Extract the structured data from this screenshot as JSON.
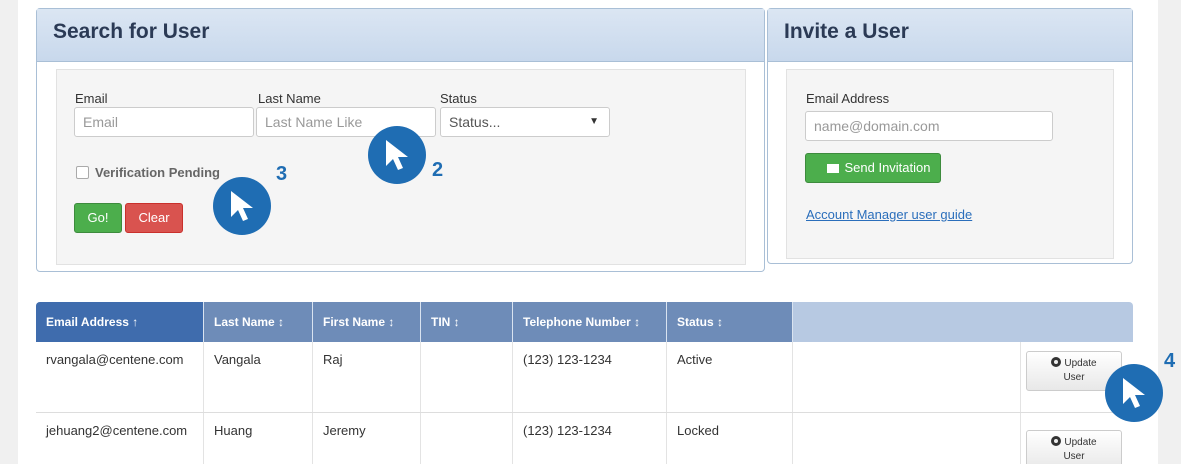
{
  "search": {
    "title": "Search for User",
    "email_label": "Email",
    "email_placeholder": "Email",
    "lastname_label": "Last Name",
    "lastname_placeholder": "Last Name Like",
    "status_label": "Status",
    "status_value": "Status...",
    "verification_label": "Verification Pending",
    "go_label": "Go!",
    "clear_label": "Clear"
  },
  "invite": {
    "title": "Invite a User",
    "email_label": "Email Address",
    "email_placeholder": "name@domain.com",
    "send_label": "Send Invitation",
    "guide_link": "Account Manager user guide"
  },
  "table": {
    "columns": [
      "Email Address ↑",
      "Last Name ↕",
      "First Name ↕",
      "TIN ↕",
      "Telephone Number ↕",
      "Status ↕"
    ],
    "update_label_1": "Update",
    "update_label_2": "User",
    "rows": [
      {
        "email": "rvangala@centene.com",
        "last": "Vangala",
        "first": "Raj",
        "tin": "",
        "phone": "(123) 123-1234",
        "status": "Active"
      },
      {
        "email": "jehuang2@centene.com",
        "last": "Huang",
        "first": "Jeremy",
        "tin": "",
        "phone": "(123) 123-1234",
        "status": "Locked"
      }
    ]
  },
  "callouts": {
    "n2": "2",
    "n3": "3",
    "n4": "4"
  },
  "colors": {
    "accent": "#1f6db3",
    "header_active": "#3f6cad",
    "go_green": "#4cae4c",
    "clear_red": "#d9534f"
  },
  "icons": [
    "cursor-callout-icon",
    "envelope-icon",
    "gear-icon",
    "caret-down-icon"
  ]
}
